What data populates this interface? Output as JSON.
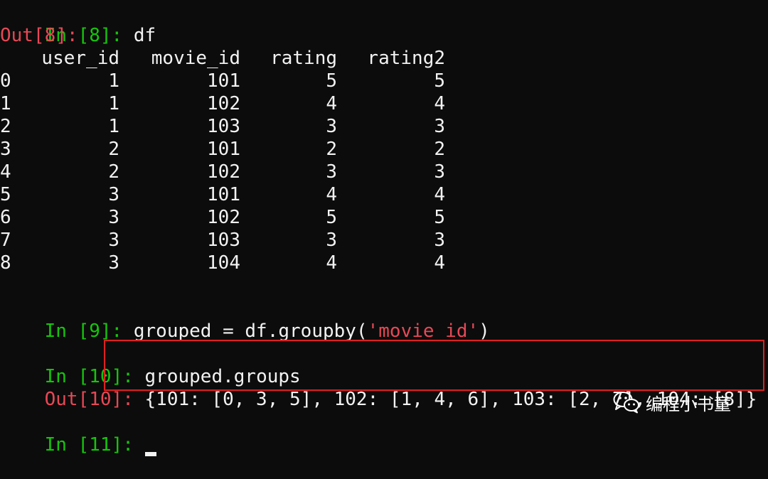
{
  "cells": {
    "in8": {
      "prompt_in": "In [",
      "num": "8",
      "prompt_close": "]: ",
      "code": "df"
    },
    "out8": {
      "prompt": "Out[8]:"
    },
    "dataframe": {
      "columns": [
        "user_id",
        "movie_id",
        "rating",
        "rating2"
      ],
      "rows": [
        [
          "0",
          "1",
          "101",
          "5",
          "5"
        ],
        [
          "1",
          "1",
          "102",
          "4",
          "4"
        ],
        [
          "2",
          "1",
          "103",
          "3",
          "3"
        ],
        [
          "3",
          "2",
          "101",
          "2",
          "2"
        ],
        [
          "4",
          "2",
          "102",
          "3",
          "3"
        ],
        [
          "5",
          "3",
          "101",
          "4",
          "4"
        ],
        [
          "6",
          "3",
          "102",
          "5",
          "5"
        ],
        [
          "7",
          "3",
          "103",
          "3",
          "3"
        ],
        [
          "8",
          "3",
          "104",
          "4",
          "4"
        ]
      ]
    },
    "in9": {
      "prompt_in": "In [",
      "num": "9",
      "prompt_close": "]: ",
      "code_before": "grouped = df.groupby(",
      "code_string": "'movie_id'",
      "code_after": ")"
    },
    "in10": {
      "prompt_in": "In [",
      "num": "10",
      "prompt_close": "]: ",
      "code": "grouped.groups"
    },
    "out10": {
      "prompt": "Out[10]: ",
      "result": "{101: [0, 3, 5], 102: [1, 4, 6], 103: [2, 7], 104: [8]}"
    },
    "in11": {
      "prompt_in": "In [",
      "num": "11",
      "prompt_close": "]: "
    }
  },
  "watermark": {
    "text": "编程小书童",
    "icon": "wechat-icon"
  },
  "colors": {
    "prompt_green": "#16c60c",
    "prompt_red": "#e74856",
    "string_red": "#e74856",
    "highlight": "#e02020",
    "background": "#0c0c0c"
  }
}
